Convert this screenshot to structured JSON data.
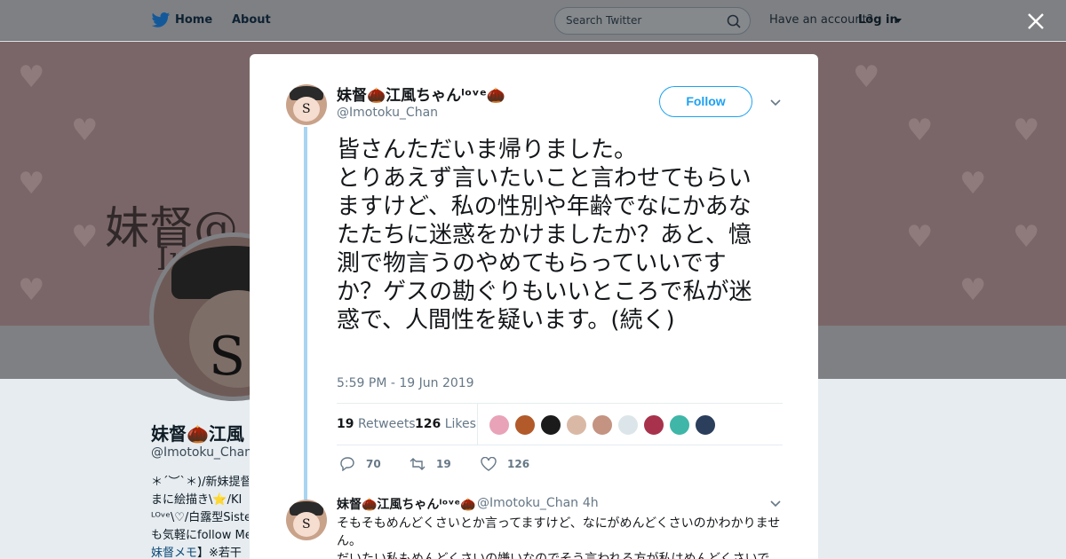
{
  "nav": {
    "home_label": "Home",
    "about_label": "About",
    "search_placeholder": "Search Twitter",
    "account_prompt": "Have an account?",
    "login_label": "Log in"
  },
  "background_profile": {
    "banner_text": "妹督@",
    "banner_subtext": "Imoto",
    "name": "妹督🌰江風",
    "handle": "@Imotoku_Chan",
    "bio_lines": [
      "＊´︶`＊)/新妹提督",
      "まに絵描き\\⭐/KI",
      "ᴸᴼᵛᵉ\\♡/白露型Siste",
      "も気軽にfollow Me"
    ],
    "bio_link": "妹督メモ",
    "bio_tail": "】※若干"
  },
  "tweet": {
    "author_name": "妹督🌰江風ちゃんˡᵒᵛᵉ🌰",
    "author_handle": "@Imotoku_Chan",
    "follow_label": "Follow",
    "text": "皆さんただいま帰りました。\nとりあえず言いたいこと言わせてもらいますけど、私の性別や年齢でなにかあなたたちに迷惑をかけましたか？あと、憶測で物言うのやめてもらっていいですか？ゲスの勘ぐりもいいところで私が迷惑で、人間性を疑います。(続く)",
    "timestamp": "5:59 PM - 19 Jun 2019",
    "retweets_count": "19",
    "retweets_label": "Retweets",
    "likes_count": "126",
    "likes_label": "Likes",
    "reply_count": "70",
    "retweet_action_count": "19",
    "like_action_count": "126"
  },
  "reply": {
    "author_name": "妹督🌰江風ちゃんˡᵒᵛᵉ🌰",
    "author_handle": "@Imotoku_Chan",
    "time": "· 4h",
    "text": "そもそもめんどくさいとか言ってますけど、なにがめんどくさいのかわかりません。\nだいたい私もめんどくさいの嫌いなのでそう言われる方が私はめんどくさいで"
  },
  "colors": {
    "accent": "#1da1f2",
    "thread_line": "#a9d5f2",
    "secondary_text": "#657786",
    "primary_text": "#14171a"
  },
  "icons": [
    "twitter-bird-icon",
    "search-icon",
    "close-icon",
    "chevron-down-icon",
    "reply-icon",
    "retweet-icon",
    "heart-icon"
  ]
}
